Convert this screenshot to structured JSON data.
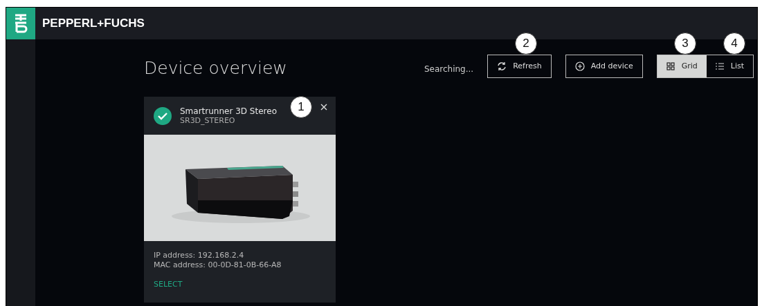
{
  "header": {
    "brand": "PEPPERL+FUCHS"
  },
  "page": {
    "title": "Device overview",
    "status": "Searching..."
  },
  "toolbar": {
    "buttons": [
      {
        "kind": "refresh",
        "label": "Refresh"
      },
      {
        "kind": "add",
        "label": "Add device"
      }
    ],
    "view_toggle": [
      {
        "kind": "grid",
        "label": "Grid",
        "selected": true
      },
      {
        "kind": "list",
        "label": "List",
        "selected": false
      }
    ]
  },
  "devices": [
    {
      "connected": true,
      "name": "Smartrunner 3D Stereo",
      "model": "SR3D_STEREO",
      "ip": "IP address: 192.168.2.4",
      "mac": "MAC address: 00-0D-81-0B-66-A8",
      "action": "SELECT"
    }
  ],
  "callouts": [
    "1",
    "2",
    "3",
    "4"
  ]
}
